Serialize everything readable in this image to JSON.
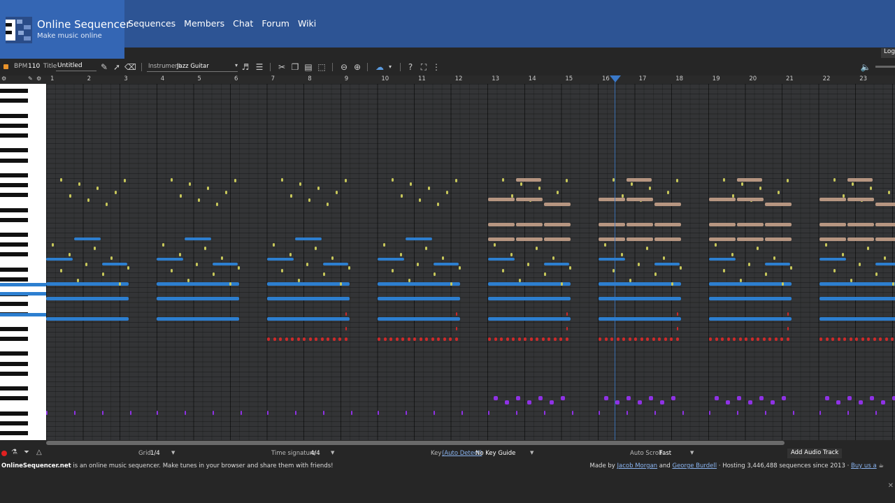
{
  "header": {
    "site_title": "Online Sequencer",
    "site_subtitle": "Make music online",
    "nav": [
      "Sequences",
      "Members",
      "Chat",
      "Forum",
      "Wiki"
    ],
    "login_label": "Login"
  },
  "toolbar": {
    "bpm_label": "BPM",
    "bpm_value": "110",
    "title_label": "Title",
    "title_value": "Untitled",
    "instrument_label": "Instrument",
    "instrument_value": "Jazz Guitar"
  },
  "ruler": {
    "bars": [
      "1",
      "2",
      "3",
      "4",
      "5",
      "6",
      "7",
      "8",
      "9",
      "10",
      "11",
      "12",
      "13",
      "14",
      "15",
      "16",
      "17",
      "18",
      "19",
      "20",
      "21",
      "22",
      "23"
    ],
    "playhead_bar": 16.25
  },
  "bottom_bar": {
    "grid_label": "Grid",
    "grid_value": "1/4",
    "time_sig_label": "Time signature",
    "time_sig_value": "4/4",
    "key_label": "Key",
    "key_auto": "(Auto Detect)",
    "key_value": "No Key Guide",
    "autoscroll_label": "Auto Scroll",
    "autoscroll_value": "Fast",
    "add_audio_track": "Add Audio Track"
  },
  "footer": {
    "site": "OnlineSequencer.net",
    "tagline": " is an online music sequencer. Make tunes in your browser and share them with friends!",
    "made_by": "Made by ",
    "author1": "Jacob Morgan",
    "and": " and ",
    "author2": "George Burdell",
    "hosting": " · Hosting 3,446,488 sequences since 2013 · ",
    "buy": "Buy us a"
  },
  "colors": {
    "header": "#2d5494",
    "logo_bg": "#3466b4",
    "note_blue": "#2d7fd0",
    "note_yellow": "#c7c75a",
    "note_tan": "#b79681",
    "note_red": "#cc2a2a",
    "note_purple": "#8f32e6",
    "playhead": "#3a79c9"
  }
}
